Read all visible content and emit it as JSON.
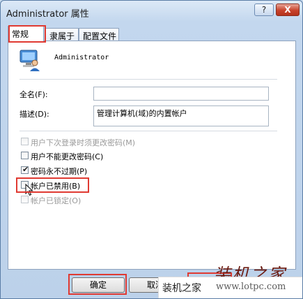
{
  "window": {
    "title": "Administrator 属性",
    "help_label": "?",
    "close_label": "X"
  },
  "tabs": [
    {
      "label": "常规"
    },
    {
      "label": "隶属于"
    },
    {
      "label": "配置文件"
    }
  ],
  "user": {
    "name": "Administrator"
  },
  "fields": {
    "fullname_label": "全名(F):",
    "fullname_value": "",
    "description_label": "描述(D):",
    "description_value": "管理计算机(域)的内置帐户"
  },
  "options": [
    {
      "label": "用户下次登录时须更改密码(M)",
      "checked": false,
      "disabled": true
    },
    {
      "label": "用户不能更改密码(C)",
      "checked": false,
      "disabled": false
    },
    {
      "label": "密码永不过期(P)",
      "checked": true,
      "disabled": false
    },
    {
      "label": "帐户已禁用(B)",
      "checked": false,
      "disabled": false
    },
    {
      "label": "帐户已锁定(O)",
      "checked": false,
      "disabled": true
    }
  ],
  "buttons": {
    "ok_label": "确定",
    "cancel_label": "取消"
  },
  "watermark": {
    "text_big": "装机之家",
    "text_small": "装机之家",
    "url": "www.lotpc.com"
  },
  "colors": {
    "highlight": "#e03a32",
    "title_bar": "#c3d7ee",
    "close_button": "#c9432c"
  }
}
